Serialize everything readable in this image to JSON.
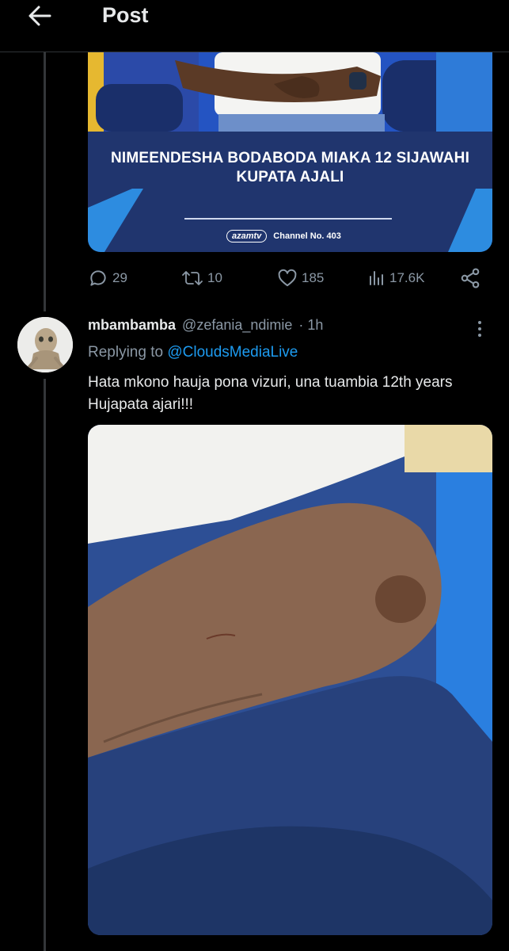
{
  "header": {
    "title": "Post",
    "back_icon": "arrow-left-icon"
  },
  "original_post": {
    "media_headline": "NIMEENDESHA BODABODA MIAKA 12 SIJAWAHI KUPATA AJALI",
    "media_logo_text": "azamtv",
    "media_channel": "Channel No. 403",
    "stats": {
      "replies": "29",
      "reposts": "10",
      "likes": "185",
      "views": "17.6K"
    }
  },
  "reply": {
    "display_name": "mbambamba",
    "handle": "@zefania_ndimie",
    "time": "· 1h",
    "replying_to_label": "Replying to",
    "replying_to_handle": "@CloudsMediaLive",
    "text": "Hata mkono hauja pona vizuri, una tuambia 12th years Hujapata ajari!!!"
  },
  "colors": {
    "background": "#000000",
    "text": "#e7e9ea",
    "muted": "#8b98a5",
    "accent": "#1d9bf0",
    "divider": "#2f3336"
  }
}
